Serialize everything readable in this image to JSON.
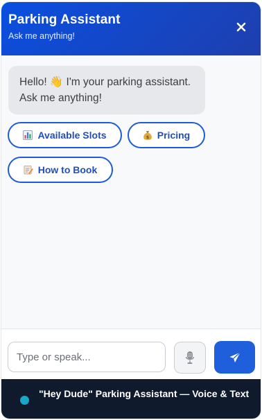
{
  "header": {
    "title": "Parking Assistant",
    "subtitle": "Ask me anything!",
    "close_label": "×"
  },
  "messages": [
    {
      "role": "assistant",
      "text": "Hello! 👋 I'm your parking assistant. Ask me anything!"
    }
  ],
  "quick_replies": [
    {
      "icon": "bar-chart-icon",
      "label": "Available Slots"
    },
    {
      "icon": "money-bag-icon",
      "label": "Pricing"
    },
    {
      "icon": "memo-icon",
      "label": "How to Book"
    }
  ],
  "composer": {
    "placeholder": "Type or speak...",
    "value": ""
  },
  "footer": {
    "status_text": "\"Hey Dude\" Parking Assistant — Voice & Text"
  },
  "colors": {
    "header_start": "#0a4fe0",
    "header_end": "#1e3fae",
    "accent": "#1f5fdc",
    "footer_bg": "#0f1b2d",
    "status_dot": "#18a7c9"
  }
}
